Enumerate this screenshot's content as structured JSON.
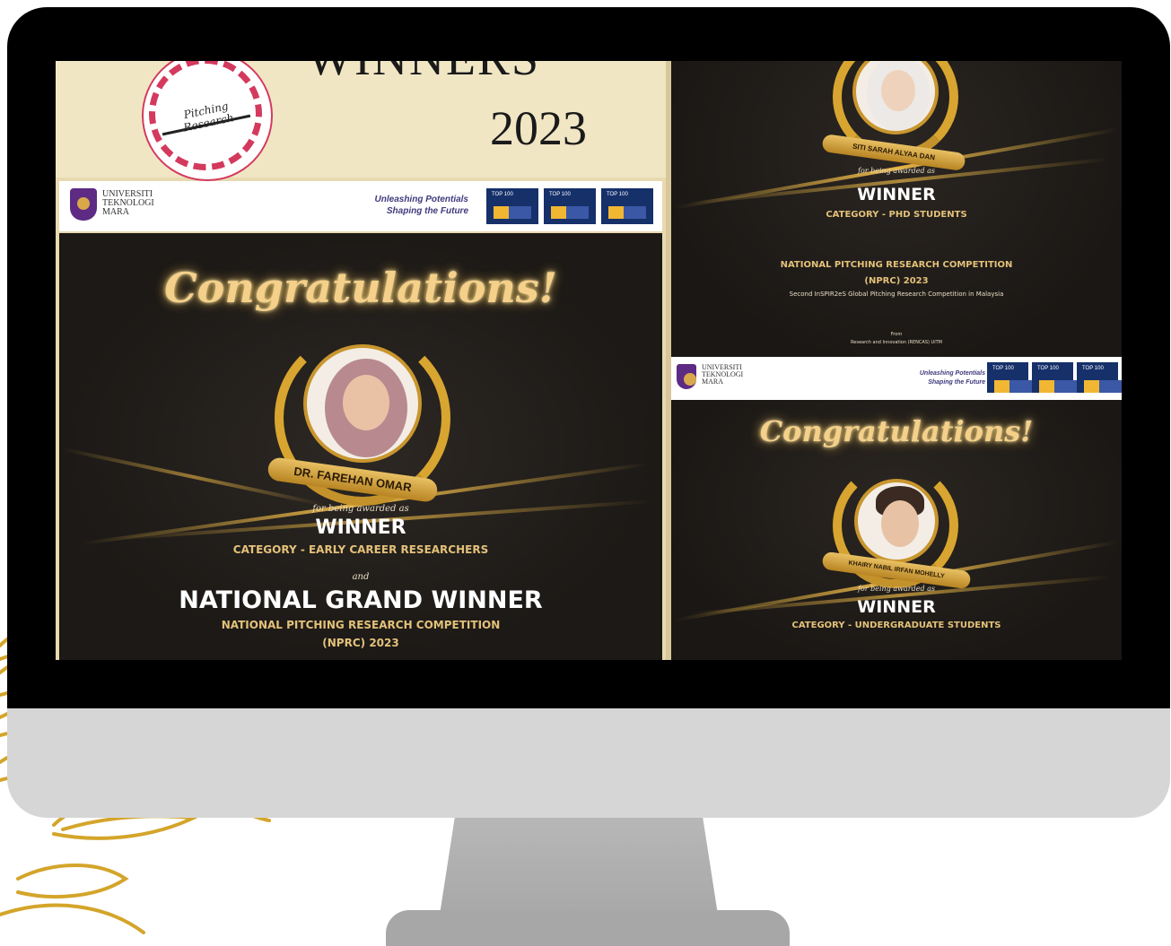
{
  "left_poster": {
    "badge_text": "Pitching Research",
    "title_line": "WINNERS",
    "year": "2023",
    "uni_name": "UNIVERSITI\nTEKNOLOGI\nMARA",
    "slogan": "Unleashing Potentials\nShaping the Future",
    "rank_labels": [
      "TOP 100",
      "TOP 100",
      "TOP 100"
    ],
    "congrats": "Congratulations!",
    "winner_name": "DR. FAREHAN OMAR",
    "awarded_text": "for being awarded as",
    "winner_title": "WINNER",
    "category": "CATEGORY - EARLY CAREER RESEARCHERS",
    "and_text": "and",
    "grand_winner": "NATIONAL GRAND WINNER",
    "competition_line1": "NATIONAL PITCHING RESEARCH COMPETITION",
    "competition_line2": "(NPRC) 2023"
  },
  "right_top_poster": {
    "winner_name": "SITI SARAH ALYAA DAN",
    "awarded_text": "for being awarded as",
    "winner_title": "WINNER",
    "category": "CATEGORY - PHD STUDENTS",
    "competition_line1": "NATIONAL PITCHING RESEARCH COMPETITION",
    "competition_line2": "(NPRC) 2023",
    "subtitle": "Second InSPIR2eS Global Pitching Research Competition in Malaysia",
    "from_label": "From",
    "from_org": "Research and Innovation (RENCAS) UiTM"
  },
  "right_uni_bar": {
    "uni_name": "UNIVERSITI\nTEKNOLOGI\nMARA",
    "slogan": "Unleashing Potentials\nShaping the Future",
    "rank_labels": [
      "TOP 100",
      "TOP 100",
      "TOP 100"
    ]
  },
  "right_bottom_poster": {
    "congrats": "Congratulations!",
    "winner_name": "KHAIRY NABIL IRFAN MOHELLY",
    "awarded_text": "for being awarded as",
    "winner_title": "WINNER",
    "category": "CATEGORY - UNDERGRADUATE STUDENTS"
  },
  "colors": {
    "gold": "#e3c179",
    "dark_bg": "#1d1a17",
    "cream": "#f1e6c4",
    "badge_pink": "#d33a5d",
    "uitm_purple": "#5d2a84"
  }
}
